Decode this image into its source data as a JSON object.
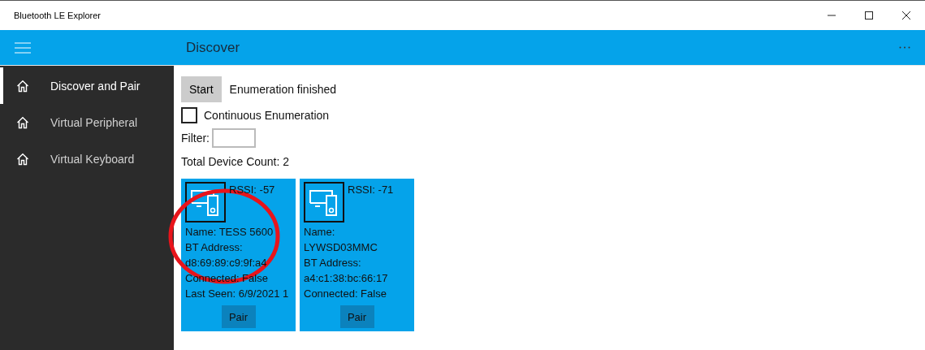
{
  "window": {
    "title": "Bluetooth LE Explorer"
  },
  "header": {
    "title": "Discover"
  },
  "nav": {
    "items": [
      {
        "label": "Discover and Pair",
        "selected": true
      },
      {
        "label": "Virtual Peripheral",
        "selected": false
      },
      {
        "label": "Virtual Keyboard",
        "selected": false
      }
    ]
  },
  "controls": {
    "start_button": "Start",
    "status": "Enumeration finished",
    "continuous": {
      "label": "Continuous Enumeration",
      "checked": false
    },
    "filter_label": "Filter:",
    "count": "Total Device Count: 2"
  },
  "devices": [
    {
      "rssi": "RSSI: -57",
      "lines": [
        "Name: TESS 5600",
        "BT Address:",
        "d8:69:89:c9:9f:a4",
        "Connected: False",
        "Last Seen: 6/9/2021 1"
      ],
      "button": "Pair"
    },
    {
      "rssi": "RSSI: -71",
      "lines": [
        "Name:",
        "LYWSD03MMC",
        "BT Address:",
        "a4:c1:38:bc:66:17",
        "Connected: False"
      ],
      "button": "Pair"
    }
  ]
}
